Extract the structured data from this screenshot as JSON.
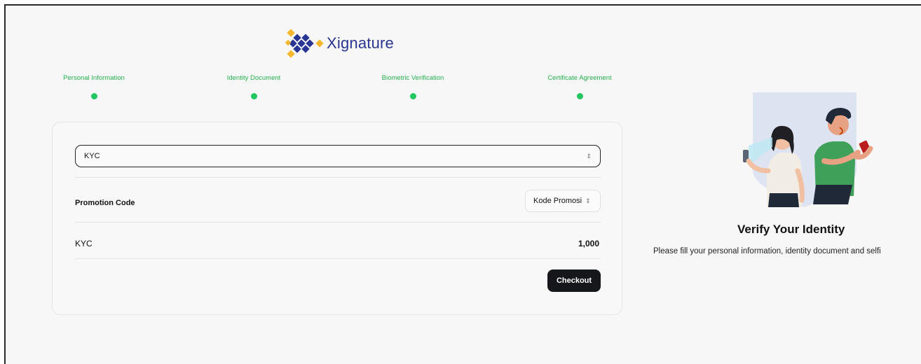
{
  "brand": {
    "name": "Xignature",
    "colors": {
      "navy": "#283593",
      "gold": "#f5b82e",
      "green": "#22c55e"
    }
  },
  "stepper": {
    "steps": [
      {
        "label": "Personal Information",
        "completed": true
      },
      {
        "label": "Identity Document",
        "completed": true
      },
      {
        "label": "Biometric Verification",
        "completed": true
      },
      {
        "label": "Certificate Agreement",
        "completed": true
      }
    ]
  },
  "form": {
    "product_select": {
      "value": "KYC"
    },
    "promotion": {
      "label": "Promotion Code",
      "select_value": "Kode Promosi"
    },
    "summary": {
      "item": "KYC",
      "price": "1,000"
    },
    "checkout_label": "Checkout"
  },
  "aside": {
    "illustration": "identity-verification-illustration",
    "title": "Verify Your Identity",
    "subtitle": "Please fill your personal information, identity document and selfi"
  }
}
